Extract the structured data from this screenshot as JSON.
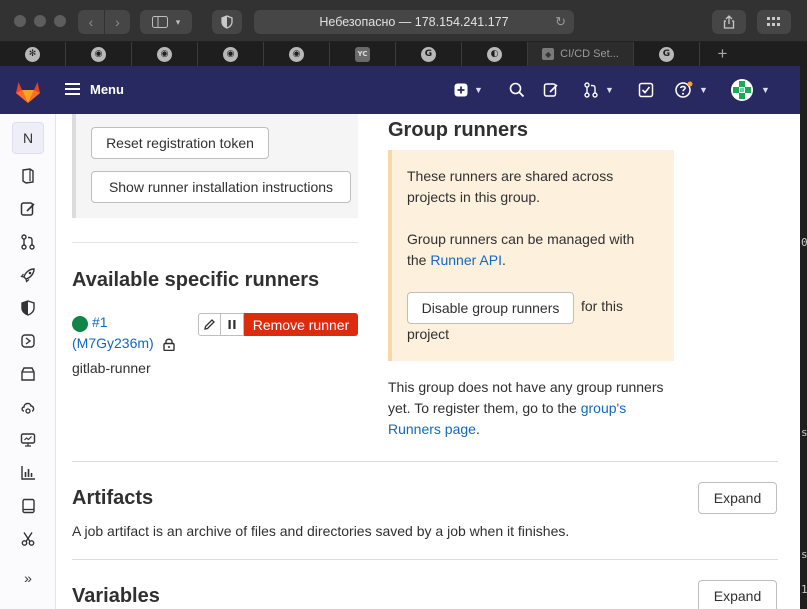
{
  "browser": {
    "address": "Небезопасно — 178.154.241.177",
    "tabs": [
      {
        "icon": "slack-icon",
        "glyph": "✻"
      },
      {
        "icon": "github-icon",
        "glyph": "◉"
      },
      {
        "icon": "github-icon",
        "glyph": "◉"
      },
      {
        "icon": "github-icon",
        "glyph": "◉"
      },
      {
        "icon": "github-icon",
        "glyph": "◉"
      },
      {
        "icon": "yc-icon",
        "glyph": "YC"
      },
      {
        "icon": "google-icon",
        "glyph": "G"
      },
      {
        "icon": "compass-icon",
        "glyph": "◐"
      },
      {
        "icon": "gitlab-icon",
        "glyph": "◆",
        "label": "CI/CD Set..."
      },
      {
        "icon": "google-icon",
        "glyph": "G"
      }
    ],
    "new_tab": "+"
  },
  "header": {
    "menu_label": "Menu"
  },
  "sidebar": {
    "project_initial": "N"
  },
  "registration": {
    "reset_token_label": "Reset registration token",
    "show_instructions_label": "Show runner installation instructions"
  },
  "specific_runners": {
    "title": "Available specific runners",
    "runner_id": "#1",
    "runner_token": "(M7Gy236m)",
    "runner_description": "gitlab-runner",
    "remove_label": "Remove runner",
    "status_color": "#108548"
  },
  "group_runners": {
    "title": "Group runners",
    "info_line1": "These runners are shared across",
    "info_line2": "projects in this group.",
    "managed_line1": "Group runners can be managed with",
    "managed_prefix": "the ",
    "api_link": "Runner API",
    "managed_suffix": ".",
    "disable_label": "Disable group runners",
    "disable_suffix": "for this",
    "disable_suffix2": "project",
    "no_runners_line1": "This group does not have any group runners",
    "no_runners_prefix": "yet. To register them, go to the ",
    "groups_link_1": "group's",
    "groups_link_2": "Runners page",
    "no_runners_suffix": "."
  },
  "artifacts": {
    "title": "Artifacts",
    "description": "A job artifact is an archive of files and directories saved by a job when it finishes.",
    "expand_label": "Expand"
  },
  "variables": {
    "title": "Variables",
    "expand_label": "Expand"
  },
  "colors": {
    "header_bg": "#292961",
    "danger": "#dd2b0e",
    "link": "#1068bf",
    "info_bg": "#fdf1dd"
  }
}
